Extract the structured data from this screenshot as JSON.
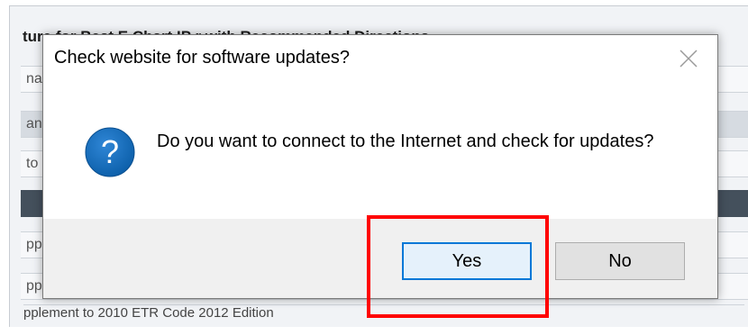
{
  "background_window": {
    "title_fragment": "ture for Best E Chart IP r    with Recommended Directions",
    "rows": [
      {
        "text": "na"
      },
      {
        "text": "an"
      },
      {
        "text": "to"
      },
      {
        "text": ""
      },
      {
        "text": "pp"
      },
      {
        "text": "pp"
      }
    ],
    "footer_fragment": "pplement to 2010 ETR Code 2012 Edition"
  },
  "dialog": {
    "title": "Check website for software updates?",
    "close_icon": "close-icon",
    "message": "Do you want to connect to the Internet and check for updates?",
    "icon": "question-icon",
    "buttons": {
      "yes_label": "Yes",
      "no_label": "No"
    }
  },
  "colors": {
    "accent": "#0078d7",
    "highlight": "#ff0000",
    "question_icon": "#0b5ea8"
  }
}
